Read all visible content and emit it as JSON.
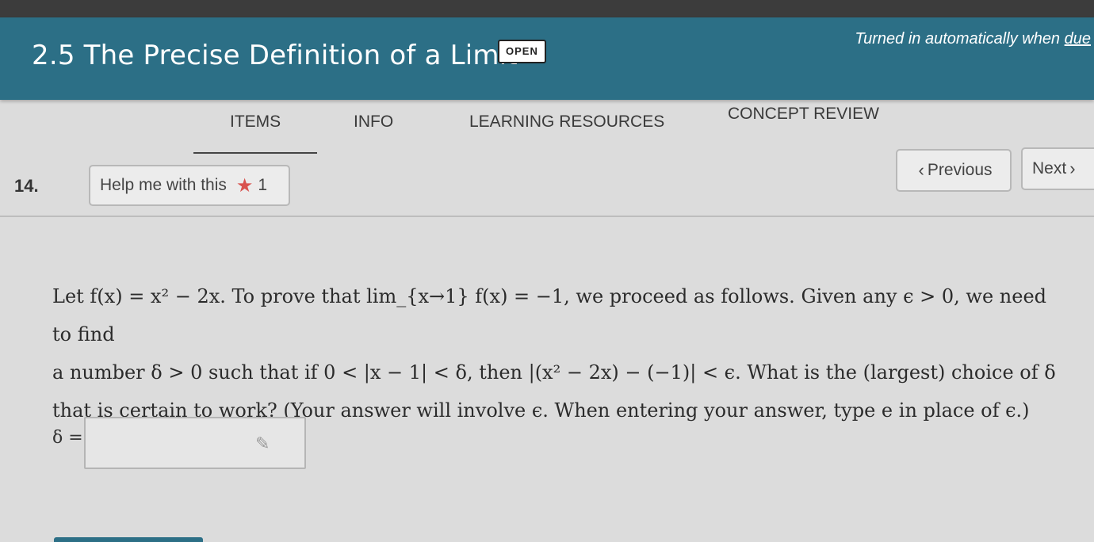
{
  "header": {
    "title": "2.5 The Precise Definition of a Limit",
    "badge": "OPEN",
    "due_prefix": "Turned in automatically when ",
    "due_link": "due"
  },
  "tabs": [
    {
      "label": "ITEMS",
      "active": true
    },
    {
      "label": "INFO",
      "active": false
    },
    {
      "label": "LEARNING RESOURCES",
      "active": false
    },
    {
      "label": "CONCEPT REVIEW",
      "active": false
    }
  ],
  "item": {
    "number": "14.",
    "help_label": "Help me with this",
    "help_count": "1",
    "prev_label": "Previous",
    "next_label": "Next"
  },
  "question": {
    "line1": "Let f(x) = x² − 2x. To prove that lim_{x→1} f(x) = −1, we proceed as follows. Given any ϵ > 0, we need to find",
    "line2": "a number δ > 0 such that if 0 < |x − 1| < δ, then |(x² − 2x) − (−1)| < ϵ. What is the (largest) choice of δ",
    "line3": "that is certain to work? (Your answer will involve ϵ. When entering your answer, type e in place of ϵ.)"
  },
  "answer": {
    "label": "δ =",
    "value": "",
    "placeholder": ""
  },
  "icons": {
    "star": "star-icon",
    "pencil": "pencil-icon",
    "chevron_left": "chevron-left-icon",
    "chevron_right": "chevron-right-icon"
  },
  "colors": {
    "header": "#2c6f86",
    "star": "#d9534f"
  }
}
